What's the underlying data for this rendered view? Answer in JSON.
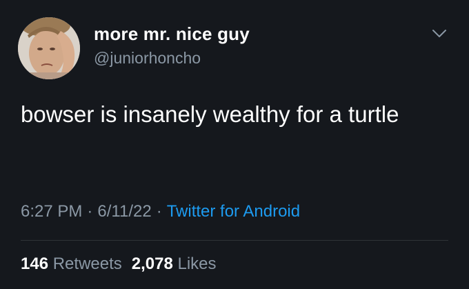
{
  "tweet": {
    "display_name": "more mr. nice guy",
    "handle": "@juniorhoncho",
    "text": "bowser is insanely wealthy for a turtle",
    "time": "6:27 PM",
    "date": "6/11/22",
    "separator": "·",
    "source": "Twitter for Android",
    "retweets_count": "146",
    "retweets_label": "Retweets",
    "likes_count": "2,078",
    "likes_label": "Likes"
  },
  "colors": {
    "background": "#15181d",
    "primary_text": "#ffffff",
    "secondary_text": "#8b98a5",
    "accent": "#1d9bf0",
    "divider": "#2f3336"
  },
  "icons": {
    "more": "chevron-down-icon",
    "avatar": "avatar"
  }
}
